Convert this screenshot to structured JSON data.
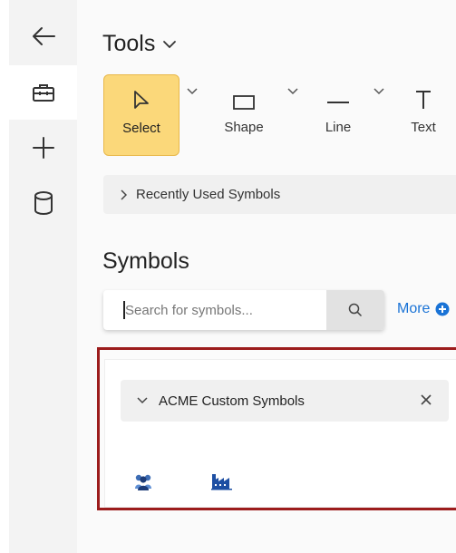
{
  "rail": {
    "items": [
      {
        "icon": "back-arrow-icon"
      },
      {
        "icon": "toolbox-icon",
        "active": true
      },
      {
        "icon": "plus-icon"
      },
      {
        "icon": "database-icon"
      }
    ]
  },
  "tools": {
    "header": "Tools",
    "items": [
      {
        "label": "Select",
        "icon": "pointer-icon",
        "selected": true
      },
      {
        "label": "Shape",
        "icon": "rectangle-icon"
      },
      {
        "label": "Line",
        "icon": "line-icon"
      },
      {
        "label": "Text",
        "icon": "text-icon"
      }
    ]
  },
  "recent": {
    "label": "Recently Used Symbols"
  },
  "symbols": {
    "title": "Symbols",
    "search_placeholder": "Search for symbols...",
    "more_label": "More"
  },
  "group": {
    "name": "ACME Custom Symbols",
    "symbols": [
      {
        "icon": "people-group-icon"
      },
      {
        "icon": "factory-icon"
      }
    ]
  },
  "colors": {
    "accent_select": "#fbd87a",
    "highlight_border": "#9c1c1c",
    "link": "#1a73d6"
  }
}
